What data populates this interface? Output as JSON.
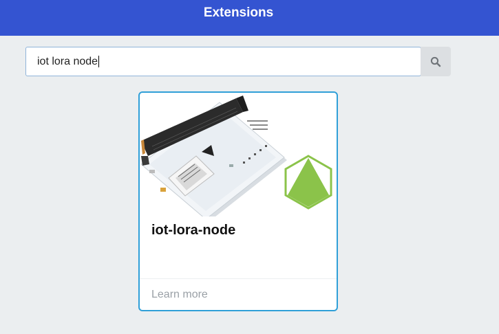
{
  "header": {
    "title": "Extensions"
  },
  "search": {
    "value": "iot lora node",
    "icon": "search-icon"
  },
  "results": [
    {
      "title": "iot-lora-node",
      "footer_link": "Learn more",
      "image": "iot-lora-node-board",
      "badge_icon": "hexagon-pyramid-icon"
    }
  ],
  "colors": {
    "header": "#3454d1",
    "card_border": "#2f9fd8",
    "badge_green": "#8bc34a",
    "background": "#ebeef0"
  }
}
